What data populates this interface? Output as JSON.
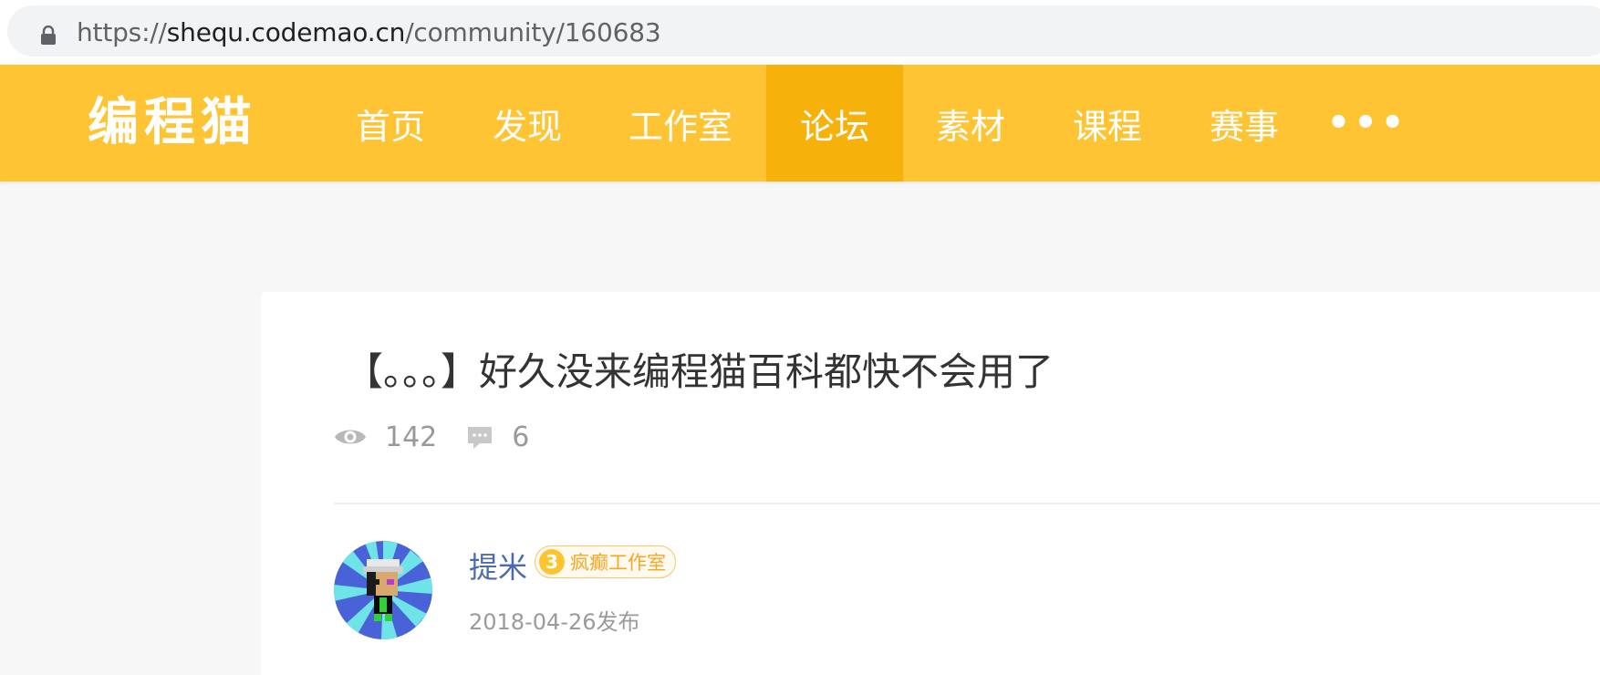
{
  "browser": {
    "url_scheme": "https://",
    "url_host": "shequ.codemao.cn",
    "url_path": "/community/160683"
  },
  "nav": {
    "logo": "编程猫",
    "items": [
      {
        "label": "首页"
      },
      {
        "label": "发现"
      },
      {
        "label": "工作室"
      },
      {
        "label": "论坛",
        "active": true
      },
      {
        "label": "素材"
      },
      {
        "label": "课程"
      },
      {
        "label": "赛事"
      },
      {
        "label": "•••"
      }
    ],
    "accent_color": "#fec433",
    "active_color": "#f6b10a"
  },
  "post": {
    "title": "【。。。】好久没来编程猫百科都快不会用了",
    "views": "142",
    "comments": "6",
    "author": {
      "name": "提米",
      "badge_level": "3",
      "badge_name": "疯癫工作室"
    },
    "publish_date": "2018-04-26发布"
  },
  "icons": {
    "lock": "lock-icon",
    "views": "eye-icon",
    "comments": "comment-icon"
  }
}
